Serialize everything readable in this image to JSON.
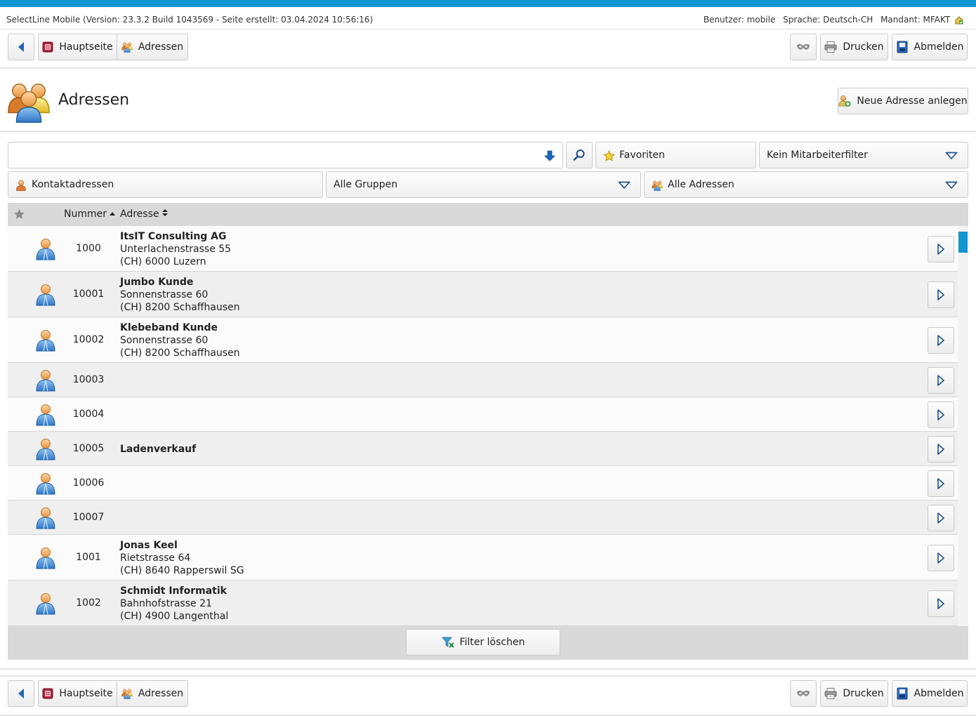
{
  "info": {
    "version_text": "SelectLine Mobile (Version: 23.3.2 Build 1043569 - Seite erstellt: 03.04.2024 10:56:16)",
    "user": "Benutzer: mobile",
    "language": "Sprache: Deutsch-CH",
    "mandant": "Mandant: MFAKT"
  },
  "toolbar": {
    "home_label": "Hauptseite",
    "addresses_label": "Adressen",
    "print_label": "Drucken",
    "logout_label": "Abmelden"
  },
  "page": {
    "title": "Adressen",
    "new_address_label": "Neue Adresse anlegen"
  },
  "filters": {
    "search_value": "",
    "favorites_label": "Favoriten",
    "employee_filter": "Kein Mitarbeiterfilter",
    "contact_addresses_label": "Kontaktadressen",
    "groups_filter": "Alle Gruppen",
    "address_filter": "Alle Adressen"
  },
  "table": {
    "col_number": "Nummer",
    "col_address": "Adresse",
    "rows": [
      {
        "number": "1000",
        "name": "ItsIT Consulting AG",
        "street": "Unterlachenstrasse 55",
        "city": "(CH) 6000 Luzern"
      },
      {
        "number": "10001",
        "name": "Jumbo Kunde",
        "street": "Sonnenstrasse 60",
        "city": "(CH) 8200 Schaffhausen"
      },
      {
        "number": "10002",
        "name": "Klebeband Kunde",
        "street": "Sonnenstrasse 60",
        "city": "(CH) 8200 Schaffhausen"
      },
      {
        "number": "10003",
        "name": "",
        "street": "",
        "city": ""
      },
      {
        "number": "10004",
        "name": "",
        "street": "",
        "city": ""
      },
      {
        "number": "10005",
        "name": "Ladenverkauf",
        "street": "",
        "city": ""
      },
      {
        "number": "10006",
        "name": "",
        "street": "",
        "city": ""
      },
      {
        "number": "10007",
        "name": "",
        "street": "",
        "city": ""
      },
      {
        "number": "1001",
        "name": "Jonas Keel",
        "street": "Rietstrasse 64",
        "city": "(CH) 8640 Rapperswil SG"
      },
      {
        "number": "1002",
        "name": "Schmidt Informatik",
        "street": "Bahnhofstrasse 21",
        "city": "(CH) 4900 Langenthal"
      }
    ],
    "clear_filter_label": "Filter löschen"
  },
  "colors": {
    "accent": "#1196d1",
    "header_gray": "#d9d9d9"
  }
}
